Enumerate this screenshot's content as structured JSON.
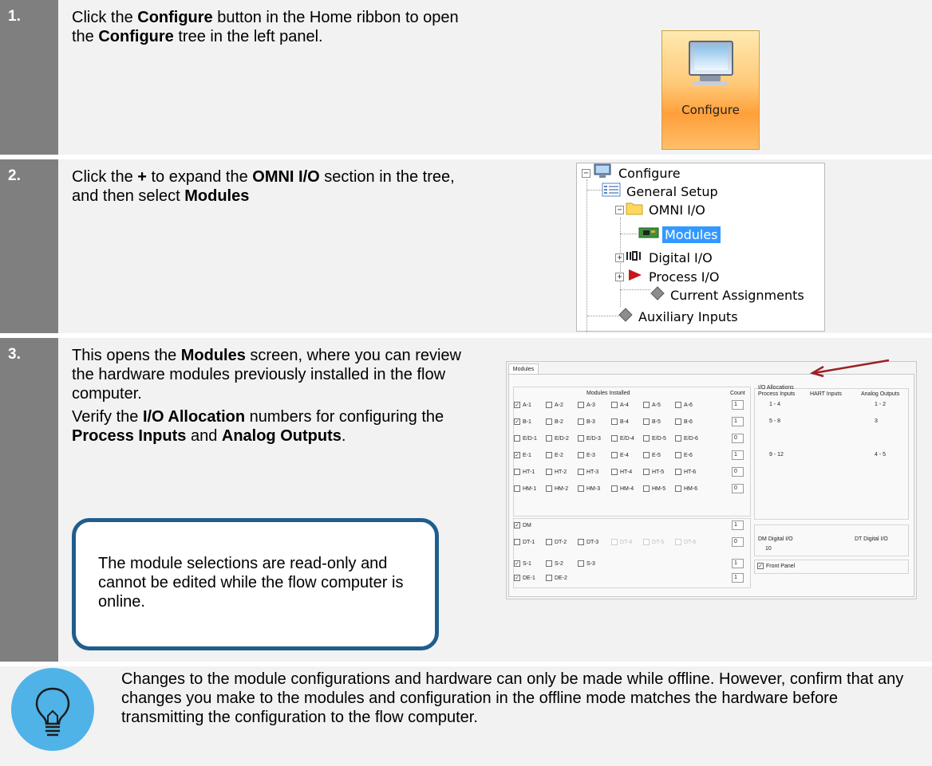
{
  "steps": [
    {
      "number": "1.",
      "text_parts": [
        "Click the ",
        "Configure",
        " button in the Home ribbon to open the ",
        "Configure",
        " tree in the left panel."
      ]
    },
    {
      "number": "2.",
      "text_parts": [
        "Click the ",
        "+",
        " to expand the ",
        "OMNI I/O",
        " section in the tree, and then select ",
        "Modules"
      ]
    },
    {
      "number": "3.",
      "para1_parts": [
        "This opens the ",
        "Modules",
        " screen, where you can review the hardware modules previously installed in the flow computer."
      ],
      "para2_parts": [
        "Verify the ",
        "I/O Allocation",
        " numbers for configuring the ",
        "Process Inputs",
        " and ",
        "Analog Outputs",
        "."
      ]
    }
  ],
  "configure_button": {
    "label": "Configure",
    "icon": "monitor-icon"
  },
  "tree": {
    "root": "Configure",
    "general_setup": "General Setup",
    "omni_io": "OMNI I/O",
    "modules": "Modules",
    "digital_io": "Digital I/O",
    "process_io": "Process I/O",
    "current_assignments": "Current Assignments",
    "auxiliary_inputs": "Auxiliary Inputs",
    "expand_open": "−",
    "expand_closed": "+"
  },
  "modules_screen": {
    "tab": "Modules",
    "modules_installed_header": "Modules Installed",
    "count_header": "Count",
    "rows": [
      {
        "items": [
          "A-1",
          "A-2",
          "A-3",
          "A-4",
          "A-5",
          "A-6"
        ],
        "checked": [
          true,
          false,
          false,
          false,
          false,
          false
        ],
        "count": "1"
      },
      {
        "items": [
          "B-1",
          "B-2",
          "B-3",
          "B-4",
          "B-5",
          "B-6"
        ],
        "checked": [
          true,
          false,
          false,
          false,
          false,
          false
        ],
        "count": "1"
      },
      {
        "items": [
          "E/D-1",
          "E/D-2",
          "E/D-3",
          "E/D-4",
          "E/D-5",
          "E/D-6"
        ],
        "checked": [
          false,
          false,
          false,
          false,
          false,
          false
        ],
        "count": "0"
      },
      {
        "items": [
          "E-1",
          "E-2",
          "E-3",
          "E-4",
          "E-5",
          "E-6"
        ],
        "checked": [
          true,
          false,
          false,
          false,
          false,
          false
        ],
        "count": "1"
      },
      {
        "items": [
          "HT-1",
          "HT-2",
          "HT-3",
          "HT-4",
          "HT-5",
          "HT-6"
        ],
        "checked": [
          false,
          false,
          false,
          false,
          false,
          false
        ],
        "count": "0"
      },
      {
        "items": [
          "HM-1",
          "HM-2",
          "HM-3",
          "HM-4",
          "HM-5",
          "HM-6"
        ],
        "checked": [
          false,
          false,
          false,
          false,
          false,
          false
        ],
        "count": "0"
      }
    ],
    "dm": {
      "label": "DM",
      "checked": true,
      "count": "1"
    },
    "dt_row": {
      "items": [
        "DT-1",
        "DT-2",
        "DT-3",
        "DT-4",
        "DT-5",
        "DT-6"
      ],
      "disabled": [
        false,
        false,
        false,
        true,
        true,
        true
      ],
      "count": "0"
    },
    "s_row": {
      "items": [
        "S-1",
        "S-2",
        "S-3"
      ],
      "checked": [
        true,
        false,
        false
      ],
      "count": "1"
    },
    "de_row": {
      "items": [
        "DE-1",
        "DE-2"
      ],
      "checked": [
        true,
        false
      ],
      "count": "1"
    },
    "io_allocations": {
      "title": "I/O Allocations",
      "headers": [
        "Process Inputs",
        "HART Inputs",
        "Analog Outputs"
      ],
      "rows": [
        {
          "process": "1 - 4",
          "analog": "1 - 2"
        },
        {
          "process": "5 - 8",
          "analog": "3"
        },
        {
          "process": "",
          "analog": ""
        },
        {
          "process": "9 - 12",
          "analog": "4 - 5"
        }
      ]
    },
    "digital": {
      "dm_label": "DM Digital I/O",
      "dt_label": "DT Digital I/O",
      "dm_value": "10"
    },
    "front_panel": {
      "label": "Front Panel",
      "checked": true
    }
  },
  "note": "The module selections are read-only and cannot be edited while the flow computer is online.",
  "tip": {
    "icon": "lightbulb-icon",
    "text": "Changes to the module configurations and hardware can only be made while offline. However, confirm that any changes you make to the modules and configuration in the offline mode matches the hardware before transmitting the configuration to the flow computer."
  },
  "colors": {
    "number_bar": "#7f7f7f",
    "row_bg": "#f2f2f2",
    "note_border": "#1f5e8c",
    "tip_icon": "#4fb3e8",
    "arrow": "#9b2226",
    "selection": "#3399ff"
  }
}
